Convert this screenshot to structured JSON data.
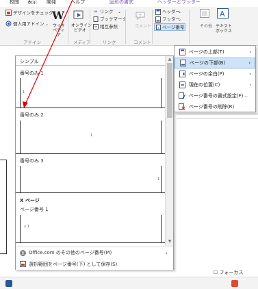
{
  "ribbon": {
    "tabs": [
      "校閲",
      "表示",
      "開発",
      "ヘルプ",
      "図形の書式",
      "ヘッダーとフッター"
    ],
    "design_label": "デザインをチェック",
    "personal_addin": "個人用アドイン",
    "wiki": "ウィキペディア",
    "online_video_line1": "オンライン",
    "online_video_line2": "ビデオ",
    "link": "リンク",
    "bookmark": "ブックマーク",
    "crossref": "相互参照",
    "comment": "コメント",
    "header": "ヘッダー",
    "footer": "フッター",
    "page_number": "ページ番号",
    "other": "その他",
    "textbox": "テキスト",
    "textbox2": "ボックス",
    "group_addin": "アドイン",
    "group_media": "メディア",
    "group_link": "リンク",
    "group_comment": "コメント"
  },
  "gallery": {
    "heading": "シンプル",
    "item1": "番号のみ 1",
    "item2": "番号のみ 2",
    "item3": "番号のみ 3",
    "section_x": "X ページ",
    "item4": "ページ番号 1",
    "num_sample": "1",
    "foot1": "Office.com のその他のページ番号(M)",
    "foot2": "選択範囲をページ番号(下) として保存(S)"
  },
  "menu": {
    "items": [
      {
        "label": "ページの上部(T)",
        "has_arrow": true
      },
      {
        "label": "ページの下部(B)",
        "has_arrow": true
      },
      {
        "label": "ページの余白(P)",
        "has_arrow": true
      },
      {
        "label": "現在の位置(C)",
        "has_arrow": true
      },
      {
        "label": "ページ番号の書式設定(F)...",
        "has_arrow": false
      },
      {
        "label": "ページ番号の削除(R)",
        "has_arrow": false
      }
    ]
  },
  "status": {
    "focus": "フォーカス"
  },
  "colors": {
    "accent": "#2b579a",
    "annotation_arrow": "#e00000",
    "menu_highlight": "#cde3f8"
  }
}
